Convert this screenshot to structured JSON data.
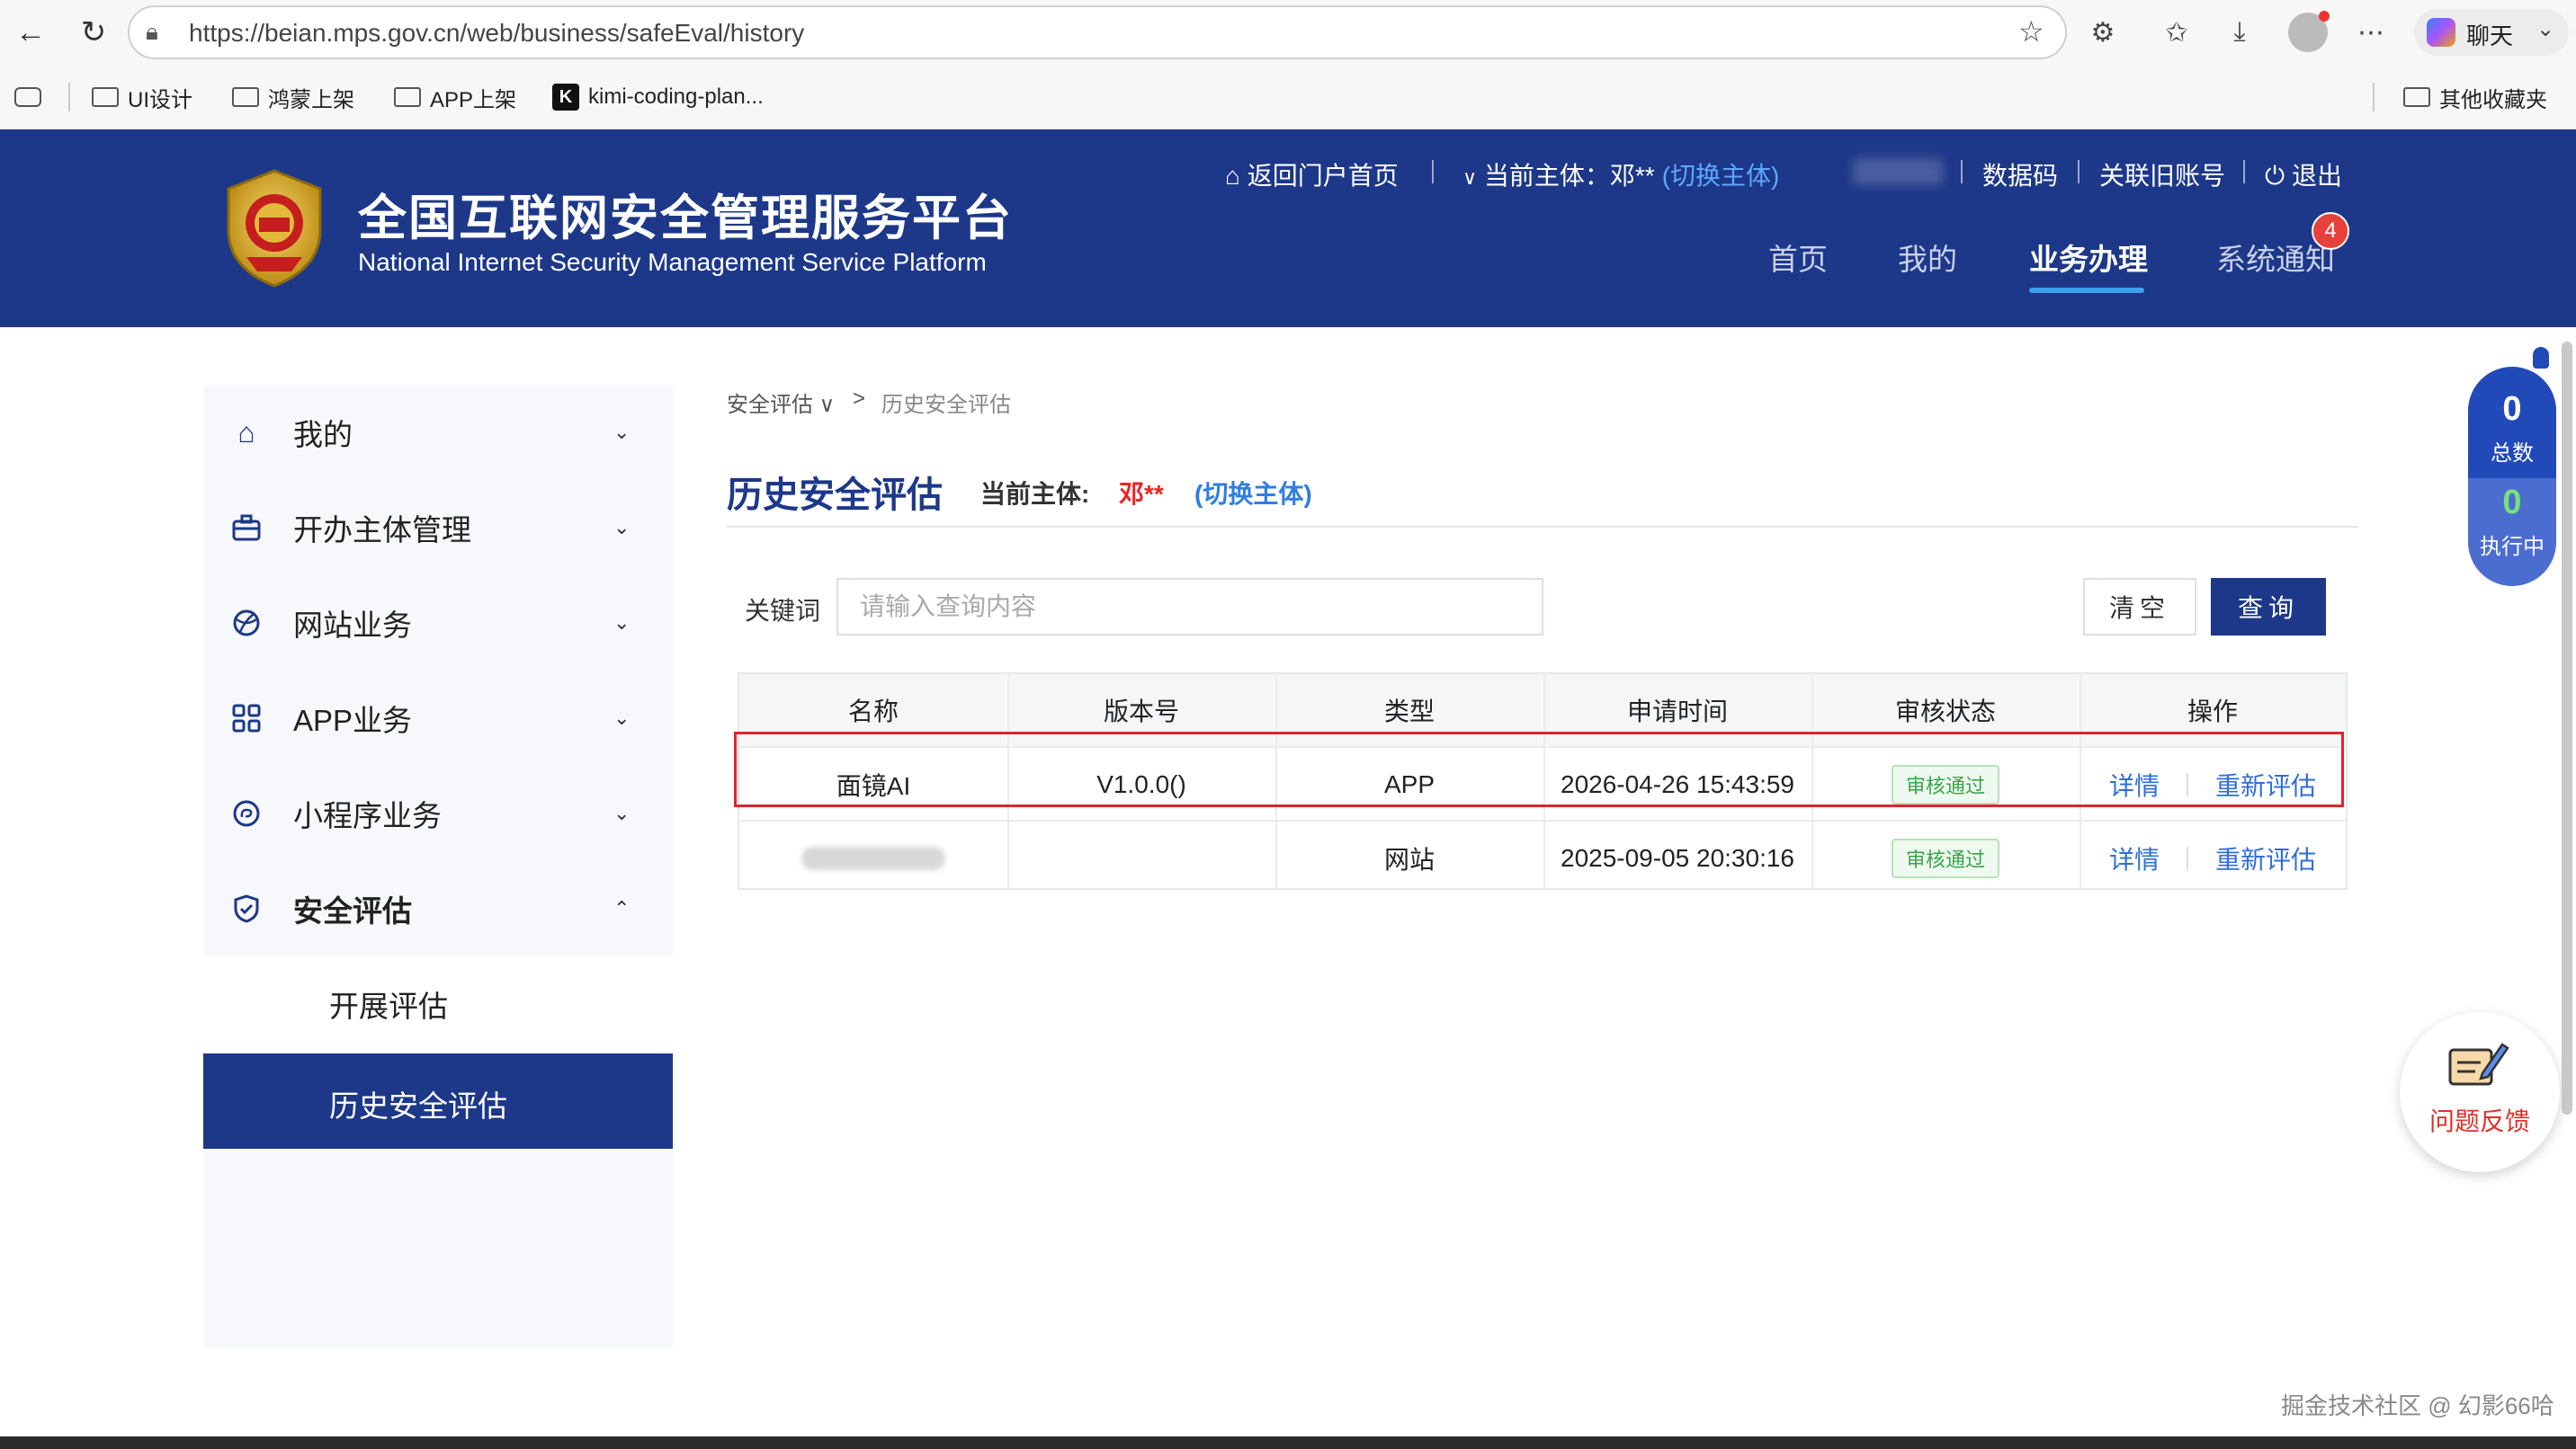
{
  "browser": {
    "url": "https://beian.mps.gov.cn/web/business/safeEval/history",
    "profile_label": "聊天",
    "bookmarks": [
      "UI设计",
      "鸿蒙上架",
      "APP上架",
      "kimi-coding-plan...",
      "其他收藏夹"
    ]
  },
  "header": {
    "title_cn": "全国互联网安全管理服务平台",
    "title_en": "National Internet Security Management Service Platform",
    "back_portal": "返回门户首页",
    "current_subject_label": "当前主体：邓**",
    "switch_subject": "(切换主体)",
    "data_code": "数据码",
    "link_old_account": "关联旧账号",
    "logout": "退出",
    "nav": [
      "首页",
      "我的",
      "业务办理",
      "系统通知"
    ],
    "notification_count": "4"
  },
  "sidebar": {
    "items": [
      {
        "label": "我的",
        "icon": "home-icon"
      },
      {
        "label": "开办主体管理",
        "icon": "briefcase-icon"
      },
      {
        "label": "网站业务",
        "icon": "globe-icon"
      },
      {
        "label": "APP业务",
        "icon": "grid-icon"
      },
      {
        "label": "小程序业务",
        "icon": "miniprogram-icon"
      },
      {
        "label": "安全评估",
        "icon": "shield-icon"
      }
    ],
    "subitems": [
      "开展评估",
      "历史安全评估"
    ]
  },
  "breadcrumb": {
    "parent": "安全评估",
    "separator": ">",
    "current": "历史安全评估"
  },
  "page": {
    "title": "历史安全评估",
    "subject_label": "当前主体:",
    "subject_name": "邓**",
    "switch_subject": "(切换主体)"
  },
  "search": {
    "keyword_label": "关键词",
    "placeholder": "请输入查询内容",
    "clear_label": "清空",
    "query_label": "查询"
  },
  "table": {
    "columns": [
      "名称",
      "版本号",
      "类型",
      "申请时间",
      "审核状态",
      "操作"
    ],
    "rows": [
      {
        "name": "面镜AI",
        "version": "V1.0.0()",
        "type": "APP",
        "time": "2026-04-26 15:43:59",
        "status": "审核通过",
        "actions": [
          "详情",
          "重新评估"
        ]
      },
      {
        "name": "",
        "version": "",
        "type": "网站",
        "time": "2025-09-05 20:30:16",
        "status": "审核通过",
        "actions": [
          "详情",
          "重新评估"
        ]
      }
    ]
  },
  "counter": {
    "total": "0",
    "total_label": "总数",
    "running": "0",
    "running_label": "执行中"
  },
  "feedback": {
    "label": "问题反馈"
  },
  "watermark": "掘金技术社区 @ 幻影66哈"
}
